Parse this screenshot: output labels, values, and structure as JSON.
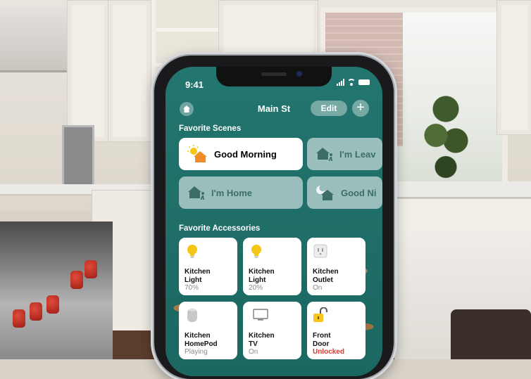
{
  "status_bar": {
    "time": "9:41"
  },
  "header": {
    "title": "Main St",
    "edit_label": "Edit",
    "add_label": "+"
  },
  "favorite_scenes": {
    "heading": "Favorite Scenes",
    "items": [
      {
        "label": "Good Morning",
        "icon": "sunrise-house-icon",
        "active": true
      },
      {
        "label": "I'm Leav",
        "icon": "leaving-house-icon",
        "active": false
      },
      {
        "label": "I'm Home",
        "icon": "arriving-house-icon",
        "active": false
      },
      {
        "label": "Good Ni",
        "icon": "moon-house-icon",
        "active": false
      }
    ]
  },
  "favorite_accessories": {
    "heading": "Favorite Accessories",
    "items": [
      {
        "name_line1": "Kitchen",
        "name_line2": "Light",
        "status": "70%",
        "icon": "lightbulb-icon"
      },
      {
        "name_line1": "Kitchen",
        "name_line2": "Light",
        "status": "20%",
        "icon": "lightbulb-icon"
      },
      {
        "name_line1": "Kitchen",
        "name_line2": "Outlet",
        "status": "On",
        "icon": "outlet-icon"
      },
      {
        "name_line1": "Kitchen",
        "name_line2": "HomePod",
        "status": "Playing",
        "icon": "homepod-icon"
      },
      {
        "name_line1": "Kitchen",
        "name_line2": "TV",
        "status": "On",
        "icon": "tv-icon"
      },
      {
        "name_line1": "Front",
        "name_line2": "Door",
        "status": "Unlocked",
        "icon": "unlocked-lock-icon"
      }
    ]
  },
  "colors": {
    "screen_bg": "#1f6f6a",
    "bulb_yellow": "#f5c518",
    "unlock_red": "#d93a2b",
    "scene_orange": "#f28c28"
  }
}
